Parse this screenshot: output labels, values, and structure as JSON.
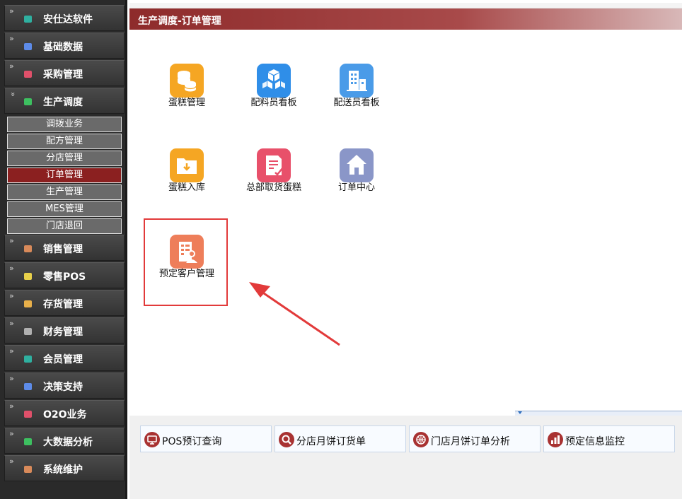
{
  "sidebar": {
    "modules": [
      {
        "label": "安仕达软件",
        "color": "#2fb0a0"
      },
      {
        "label": "基础数据",
        "color": "#5d8be8"
      },
      {
        "label": "采购管理",
        "color": "#e0506a"
      },
      {
        "label": "生产调度",
        "color": "#3dc060"
      },
      {
        "label": "销售管理",
        "color": "#d88a5a"
      },
      {
        "label": "零售POS",
        "color": "#e8d04a"
      },
      {
        "label": "存货管理",
        "color": "#e8b04a"
      },
      {
        "label": "财务管理",
        "color": "#b0b0b0"
      },
      {
        "label": "会员管理",
        "color": "#2fb0a0"
      },
      {
        "label": "决策支持",
        "color": "#5d8be8"
      },
      {
        "label": "O2O业务",
        "color": "#e0506a"
      },
      {
        "label": "大数据分析",
        "color": "#3dc060"
      },
      {
        "label": "系统维护",
        "color": "#d88a5a"
      }
    ],
    "chevron_collapsed": "»",
    "chevron_expanded": "»",
    "sub_items": [
      {
        "label": "调拨业务"
      },
      {
        "label": "配方管理"
      },
      {
        "label": "分店管理"
      },
      {
        "label": "订单管理"
      },
      {
        "label": "生产管理"
      },
      {
        "label": "MES管理"
      },
      {
        "label": "门店退回"
      }
    ]
  },
  "header": {
    "title": "生产调度-订单管理"
  },
  "apps": [
    {
      "label": "蛋糕管理",
      "icon": "coin-stack-icon",
      "color": "#f5a623"
    },
    {
      "label": "配料员看板",
      "icon": "boxes-icon",
      "color": "#2f8ee8"
    },
    {
      "label": "配送员看板",
      "icon": "building-icon",
      "color": "#4a9be8"
    },
    {
      "label": "蛋糕入库",
      "icon": "folder-download-icon",
      "color": "#f5a623"
    },
    {
      "label": "总部取货蛋糕",
      "icon": "document-edit-icon",
      "color": "#e8506a"
    },
    {
      "label": "订单中心",
      "icon": "home-icon",
      "color": "#8a96c8"
    },
    {
      "label": "预定客户管理",
      "icon": "customer-file-icon",
      "color": "#ee7e5a"
    }
  ],
  "quick_buttons": [
    {
      "label": "POS预订查询",
      "icon": "monitor-icon"
    },
    {
      "label": "分店月饼订货单",
      "icon": "search-icon"
    },
    {
      "label": "门店月饼订单分析",
      "icon": "basketball-icon"
    },
    {
      "label": "预定信息监控",
      "icon": "bar-chart-icon"
    }
  ],
  "colors": {
    "accent": "#8e2b2b",
    "highlight": "#e23a3a"
  }
}
